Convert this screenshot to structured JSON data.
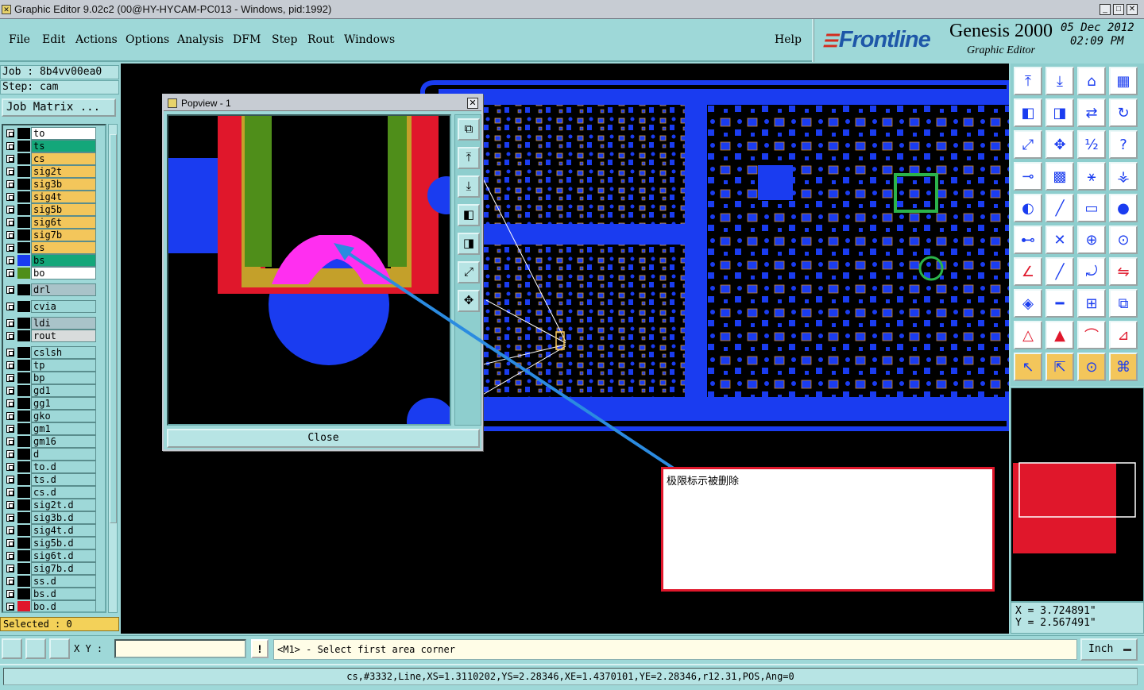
{
  "title_bar": {
    "text": "Graphic Editor 9.02c2 (00@HY-HYCAM-PC013 - Windows, pid:1992)",
    "icon": "app-window-icon",
    "buttons": {
      "minimize": "_",
      "maximize": "□",
      "close": "✕"
    }
  },
  "menu": [
    "File",
    "Edit",
    "Actions",
    "Options",
    "Analysis",
    "DFM",
    "Step",
    "Rout",
    "Windows"
  ],
  "help": "Help",
  "brand": {
    "logo": "Frontline",
    "product": "Genesis 2000",
    "subtitle": "Graphic Editor",
    "date": "05  Dec  2012",
    "time": "02:09  PM"
  },
  "job": {
    "job_line": "Job : 8b4vv00ea0",
    "step_line": "Step: cam",
    "job_matrix_button": "Job Matrix ..."
  },
  "layers": [
    {
      "name": "to",
      "color": "#ffffff",
      "swatch": "#000000",
      "group": 0
    },
    {
      "name": "ts",
      "color": "#14a77a",
      "swatch": "#000000",
      "group": 0
    },
    {
      "name": "cs",
      "color": "#f3c65b",
      "swatch": "#000000",
      "group": 0
    },
    {
      "name": "sig2t",
      "color": "#f3c65b",
      "swatch": "#000000",
      "group": 0
    },
    {
      "name": "sig3b",
      "color": "#f3c65b",
      "swatch": "#000000",
      "group": 0
    },
    {
      "name": "sig4t",
      "color": "#f3c65b",
      "swatch": "#000000",
      "group": 0
    },
    {
      "name": "sig5b",
      "color": "#f3c65b",
      "swatch": "#000000",
      "group": 0
    },
    {
      "name": "sig6t",
      "color": "#f3c65b",
      "swatch": "#000000",
      "group": 0
    },
    {
      "name": "sig7b",
      "color": "#f3c65b",
      "swatch": "#000000",
      "group": 0
    },
    {
      "name": "ss",
      "color": "#f3c65b",
      "swatch": "#000000",
      "group": 0
    },
    {
      "name": "bs",
      "color": "#14a77a",
      "swatch": "#1a3cf0",
      "group": 0
    },
    {
      "name": "bo",
      "color": "#ffffff",
      "swatch": "#4f8e1a",
      "group": 0
    },
    {
      "name": "drl",
      "color": "#a9c3c9",
      "swatch": "#000000",
      "group": 1
    },
    {
      "name": "cvia",
      "color": "#9ed8d8",
      "swatch": "#000000",
      "group": 2
    },
    {
      "name": "ldi",
      "color": "#a9c3c9",
      "swatch": "#000000",
      "group": 3
    },
    {
      "name": "rout",
      "color": "#d8dcdc",
      "swatch": "#000000",
      "group": 3
    },
    {
      "name": "cslsh",
      "color": "#9ed8d8",
      "swatch": "#000000",
      "group": 4
    },
    {
      "name": "tp",
      "color": "#9ed8d8",
      "swatch": "#000000",
      "group": 4
    },
    {
      "name": "bp",
      "color": "#9ed8d8",
      "swatch": "#000000",
      "group": 4
    },
    {
      "name": "gd1",
      "color": "#9ed8d8",
      "swatch": "#000000",
      "group": 4
    },
    {
      "name": "gg1",
      "color": "#9ed8d8",
      "swatch": "#000000",
      "group": 4
    },
    {
      "name": "gko",
      "color": "#9ed8d8",
      "swatch": "#000000",
      "group": 4
    },
    {
      "name": "gm1",
      "color": "#9ed8d8",
      "swatch": "#000000",
      "group": 4
    },
    {
      "name": "gm16",
      "color": "#9ed8d8",
      "swatch": "#000000",
      "group": 4
    },
    {
      "name": "d",
      "color": "#9ed8d8",
      "swatch": "#000000",
      "group": 4
    },
    {
      "name": "to.d",
      "color": "#9ed8d8",
      "swatch": "#000000",
      "group": 4
    },
    {
      "name": "ts.d",
      "color": "#9ed8d8",
      "swatch": "#000000",
      "group": 4
    },
    {
      "name": "cs.d",
      "color": "#9ed8d8",
      "swatch": "#000000",
      "group": 4
    },
    {
      "name": "sig2t.d",
      "color": "#9ed8d8",
      "swatch": "#000000",
      "group": 4
    },
    {
      "name": "sig3b.d",
      "color": "#9ed8d8",
      "swatch": "#000000",
      "group": 4
    },
    {
      "name": "sig4t.d",
      "color": "#9ed8d8",
      "swatch": "#000000",
      "group": 4
    },
    {
      "name": "sig5b.d",
      "color": "#9ed8d8",
      "swatch": "#000000",
      "group": 4
    },
    {
      "name": "sig6t.d",
      "color": "#9ed8d8",
      "swatch": "#000000",
      "group": 4
    },
    {
      "name": "sig7b.d",
      "color": "#9ed8d8",
      "swatch": "#000000",
      "group": 4
    },
    {
      "name": "ss.d",
      "color": "#9ed8d8",
      "swatch": "#000000",
      "group": 4
    },
    {
      "name": "bs.d",
      "color": "#9ed8d8",
      "swatch": "#000000",
      "group": 4
    },
    {
      "name": "bo.d",
      "color": "#9ed8d8",
      "swatch": "#e0172b",
      "group": 4
    }
  ],
  "selected": "Selected : 0",
  "popview": {
    "title": "Popview - 1",
    "close_button": "Close",
    "tool_icons": [
      "fit-window-icon",
      "zoom-up-icon",
      "zoom-down-icon",
      "pan-left-icon",
      "pan-right-icon",
      "zoom-fit-icon",
      "center-icon"
    ]
  },
  "callout_text": "极限标示被删除",
  "right_toolbar": [
    "zoom-home-icon",
    "zoom-down-icon",
    "home-icon",
    "grid-view-icon",
    "pan-left-icon",
    "pan-right-icon",
    "mirror-icon",
    "redraw-icon",
    "zoom-fit-icon",
    "zoom-center-icon",
    "scale-1-2-icon",
    "help-icon",
    "measure-icon",
    "grid-icon",
    "net-highlight-icon",
    "net-display-icon",
    "add-pad-icon",
    "draw-line-icon",
    "ruler-icon",
    "pad-icon",
    "connect-nodes-icon",
    "delete-node-icon",
    "move-node-icon",
    "add-node-icon",
    "angle-icon",
    "slash-icon",
    "arc-icon",
    "flip-icon",
    "add-feature-icon",
    "cut-line-icon",
    "resize-icon",
    "group-icon",
    "delta-icon",
    "triangle-up-icon",
    "triangle-arc-icon",
    "triangle-wide-icon",
    "select-cursor-icon",
    "select-box-icon",
    "select-circle-icon",
    "select-net-icon"
  ],
  "coordinates": {
    "x": "X = 3.724891\"",
    "y": "Y = 2.567491\""
  },
  "bottom": {
    "xy_label": "X Y :",
    "xy_value": "",
    "exclaim": "!",
    "prompt": "<M1> - Select first area corner",
    "unit": "Inch"
  },
  "status": "cs,#3332,Line,XS=1.3110202,YS=2.28346,XE=1.4370101,YE=2.28346,r12.31,POS,Ang=0"
}
